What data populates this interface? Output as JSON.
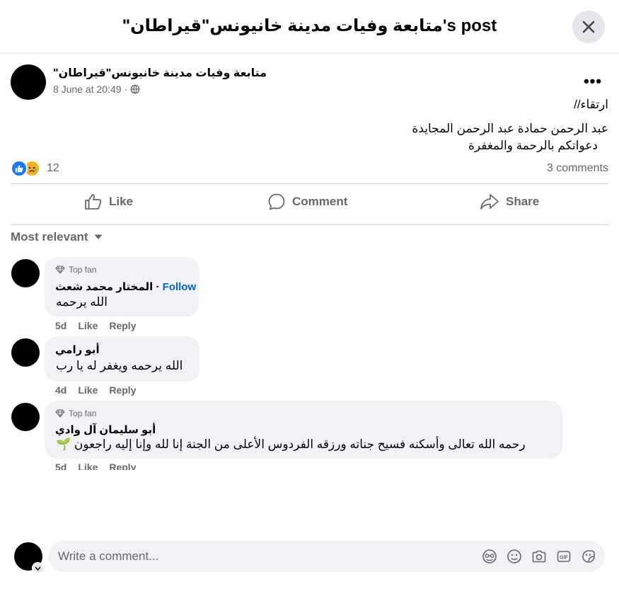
{
  "header": {
    "title": "\"متابعة وفيات مدينة خانيونس\"قيراطان's post"
  },
  "post": {
    "author": "\"متابعة وفيات مدينة خانيونس\"قيراطان",
    "timestamp": "8 June at 20:49",
    "privacy_icon": "globe-icon",
    "text_lines": [
      "ارتقاء//",
      "عبد الرحمن حمادة عبد الرحمن المجايدة",
      "دعواتكم بالرحمة والمغفرة"
    ],
    "reaction_count": "12",
    "comment_count": "3 comments"
  },
  "actions": {
    "like": "Like",
    "comment": "Comment",
    "share": "Share"
  },
  "sort": {
    "label": "Most relevant"
  },
  "comments": [
    {
      "badge": "Top fan",
      "name": "المختار محمد شعث",
      "follow": "Follow",
      "text": "الله يرحمه",
      "time": "5d",
      "like": "Like",
      "reply": "Reply"
    },
    {
      "name": "أبو رامي",
      "text": "الله يرحمه ويغفر له يا رب",
      "time": "4d",
      "like": "Like",
      "reply": "Reply"
    },
    {
      "badge": "Top fan",
      "name": "أبو سليمان آل وادي",
      "text": "رحمه الله تعالى وأسكنه فسيح جناته ورزقه الفردوس الأعلى من الجنة إنا لله وإنا إليه راجعون 🌱",
      "time": "5d",
      "like": "Like",
      "reply": "Reply"
    }
  ],
  "composer": {
    "placeholder": "Write a comment...",
    "icons": [
      "avatar-sticker-icon",
      "emoji-icon",
      "camera-icon",
      "gif-icon",
      "sticker-icon"
    ]
  },
  "colors": {
    "accent": "#1877f2",
    "link": "#0064d1",
    "secondary_text": "#65676b",
    "bubble": "#f0f2f5"
  }
}
